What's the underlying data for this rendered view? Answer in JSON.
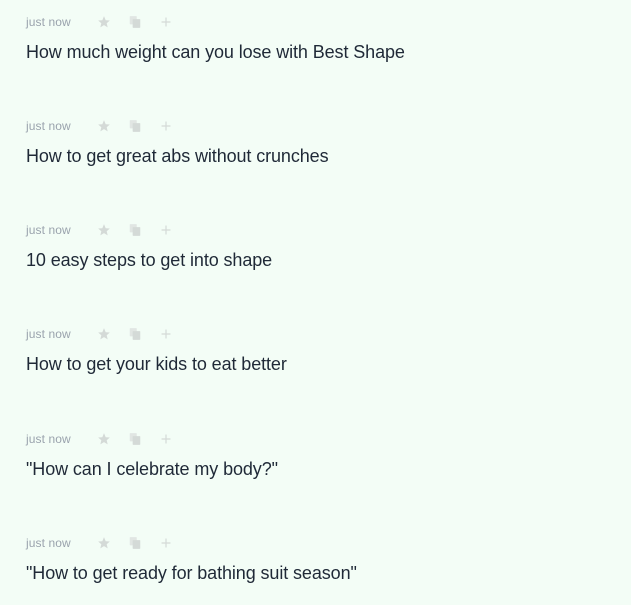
{
  "feed": {
    "items": [
      {
        "time": "just now",
        "title": "How much weight can you lose with Best Shape"
      },
      {
        "time": "just now",
        "title": "How to get great abs without crunches"
      },
      {
        "time": "just now",
        "title": "10 easy steps to get into shape"
      },
      {
        "time": "just now",
        "title": "How to get your kids to eat better"
      },
      {
        "time": "just now",
        "title": "\"How can I celebrate my body?\""
      },
      {
        "time": "just now",
        "title": "\"How to get ready for bathing suit season\""
      }
    ],
    "icons": {
      "favorite": "star-icon",
      "copy": "copy-icon",
      "add": "plus-icon"
    },
    "colors": {
      "background": "#f3fdf6",
      "text": "#1f2937",
      "muted": "#9aa3ad",
      "icon": "#d4dad7"
    }
  }
}
